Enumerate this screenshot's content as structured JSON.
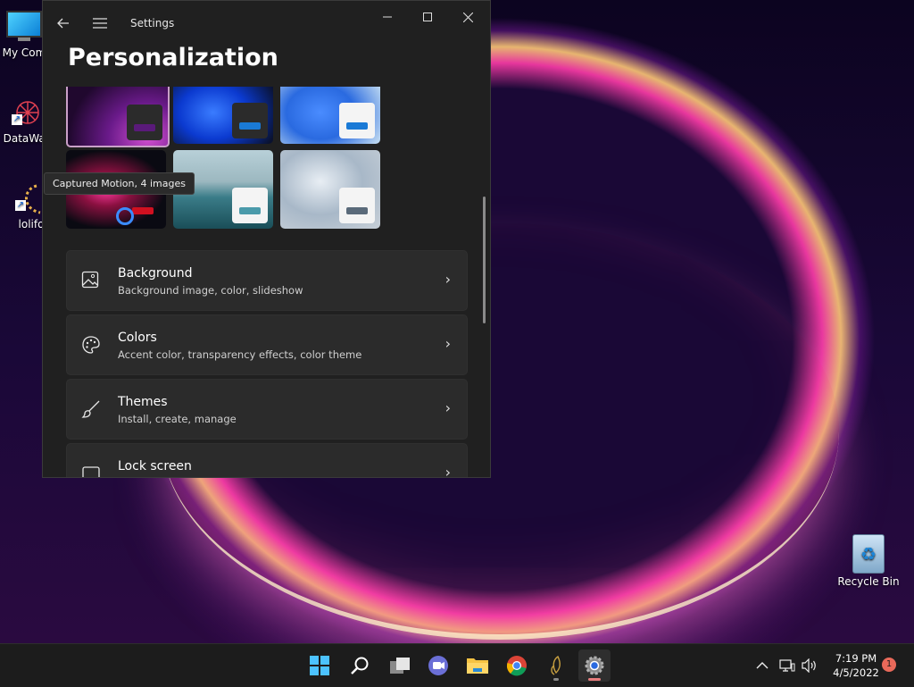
{
  "desktop": {
    "icons": [
      {
        "label": "My Com"
      },
      {
        "label": "DataWag"
      },
      {
        "label": "lolifo"
      },
      {
        "label": "Recycle Bin"
      }
    ]
  },
  "window": {
    "title": "Settings",
    "page_title": "Personalization",
    "tooltip": "Captured Motion, 4 images",
    "settings_items": [
      {
        "title": "Background",
        "subtitle": "Background image, color, slideshow",
        "icon": "picture-icon"
      },
      {
        "title": "Colors",
        "subtitle": "Accent color, transparency effects, color theme",
        "icon": "palette-icon"
      },
      {
        "title": "Themes",
        "subtitle": "Install, create, manage",
        "icon": "brush-icon"
      },
      {
        "title": "Lock screen",
        "subtitle": "",
        "icon": "lock-screen-icon"
      }
    ],
    "themes": [
      {
        "accent": "#5a1a7a"
      },
      {
        "accent": "#1a7ad6"
      },
      {
        "accent": "#1a7ad6"
      },
      {
        "accent": "#d01020"
      },
      {
        "accent": "#4a9aaa"
      },
      {
        "accent": "#5a6a7a"
      }
    ]
  },
  "taskbar": {
    "apps": [
      "start-icon",
      "search-icon",
      "task-view-icon",
      "chat-icon",
      "file-explorer-icon",
      "chrome-icon",
      "app-icon",
      "settings-icon"
    ],
    "clock": {
      "time": "7:19 PM",
      "date": "4/5/2022"
    },
    "notification_count": "1"
  }
}
